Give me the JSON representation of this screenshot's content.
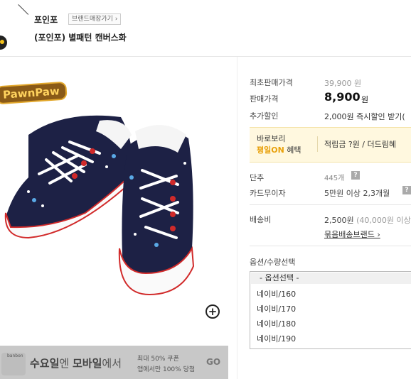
{
  "header": {
    "brand": "포인포",
    "brand_shop_button": "브랜드매장가기",
    "product_title": "(포인포) 별패턴 캔버스화"
  },
  "logo": {
    "text_left": "Paw",
    "text_mid": "n",
    "text_right": "Paw"
  },
  "banner": {
    "app_label": "banbon",
    "headline_part1": "수요일",
    "headline_part2": "엔 ",
    "headline_part3": "모바일",
    "headline_part4": "에서",
    "sub1": "최대 50% 쿠폰",
    "sub2": "앱에서만 100% 당첨",
    "go": "GO"
  },
  "info": {
    "orig_price_label": "최초판매가격",
    "orig_price_value": "39,900 원",
    "sale_price_label": "판매가격",
    "sale_price_value": "8,900",
    "sale_price_unit": "원",
    "discount_label": "추가할인",
    "discount_value": "2,000원 즉시할인 받기(",
    "promo_line1": "바로보리",
    "promo_highlight": "평일ON",
    "promo_line2_rest": " 혜택",
    "promo_points": "적립금 ?원 / 더드림혜",
    "stock_label": "단추",
    "stock_value": "445개",
    "card_label": "카드무이자",
    "card_value": "5만원 이상 2,3개월",
    "ship_label": "배송비",
    "ship_value": "2,500원",
    "ship_value_muted": "(40,000원 이상",
    "ship_link": "묶음배송브랜드 ›",
    "help_glyph": "?"
  },
  "options": {
    "label": "옵션/수량선택",
    "placeholder": "- 옵션선택 -",
    "items": [
      "네이비/160",
      "네이비/170",
      "네이비/180",
      "네이비/190"
    ]
  },
  "icons": {
    "zoom": "+"
  }
}
